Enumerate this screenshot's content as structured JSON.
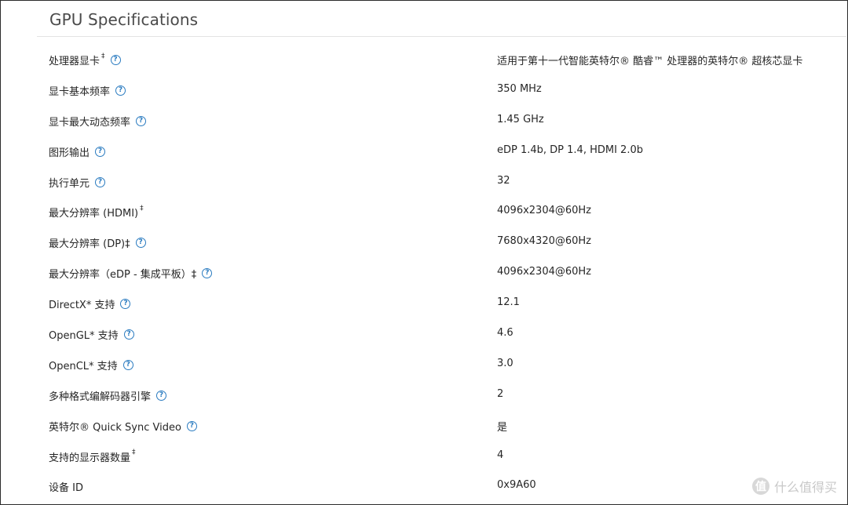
{
  "section": {
    "title": "GPU Specifications"
  },
  "help_icon_glyph": "?",
  "rows": [
    {
      "label": "处理器显卡",
      "sup": "‡",
      "help": true,
      "value": "适用于第十一代智能英特尔® 酷睿™ 处理器的英特尔® 超核芯显卡"
    },
    {
      "label": "显卡基本频率",
      "sup": "",
      "help": true,
      "value": "350 MHz"
    },
    {
      "label": "显卡最大动态频率",
      "sup": "",
      "help": true,
      "value": "1.45 GHz"
    },
    {
      "label": "图形输出",
      "sup": "",
      "help": true,
      "value": "eDP 1.4b, DP 1.4, HDMI 2.0b"
    },
    {
      "label": "执行单元",
      "sup": "",
      "help": true,
      "value": "32"
    },
    {
      "label": "最大分辨率 (HDMI)",
      "sup": "‡",
      "help": false,
      "value": "4096x2304@60Hz"
    },
    {
      "label": "最大分辨率 (DP)‡",
      "sup": "",
      "help": true,
      "value": "7680x4320@60Hz"
    },
    {
      "label": "最大分辨率（eDP - 集成平板）‡",
      "sup": "",
      "help": true,
      "value": "4096x2304@60Hz"
    },
    {
      "label": "DirectX* 支持",
      "sup": "",
      "help": true,
      "value": "12.1"
    },
    {
      "label": "OpenGL* 支持",
      "sup": "",
      "help": true,
      "value": "4.6"
    },
    {
      "label": "OpenCL* 支持",
      "sup": "",
      "help": true,
      "value": "3.0"
    },
    {
      "label": "多种格式编解码器引擎",
      "sup": "",
      "help": true,
      "value": "2"
    },
    {
      "label": "英特尔® Quick Sync Video",
      "sup": "",
      "help": true,
      "value": "是"
    },
    {
      "label": "支持的显示器数量",
      "sup": "‡",
      "help": false,
      "value": "4"
    },
    {
      "label": "设备 ID",
      "sup": "",
      "help": false,
      "value": "0x9A60"
    }
  ],
  "watermark": {
    "badge": "值",
    "text": "什么值得买"
  },
  "colors": {
    "help_icon": "#2a7bc0",
    "text": "#262626",
    "title": "#4a4a4a",
    "rule": "#e3e3e3"
  }
}
